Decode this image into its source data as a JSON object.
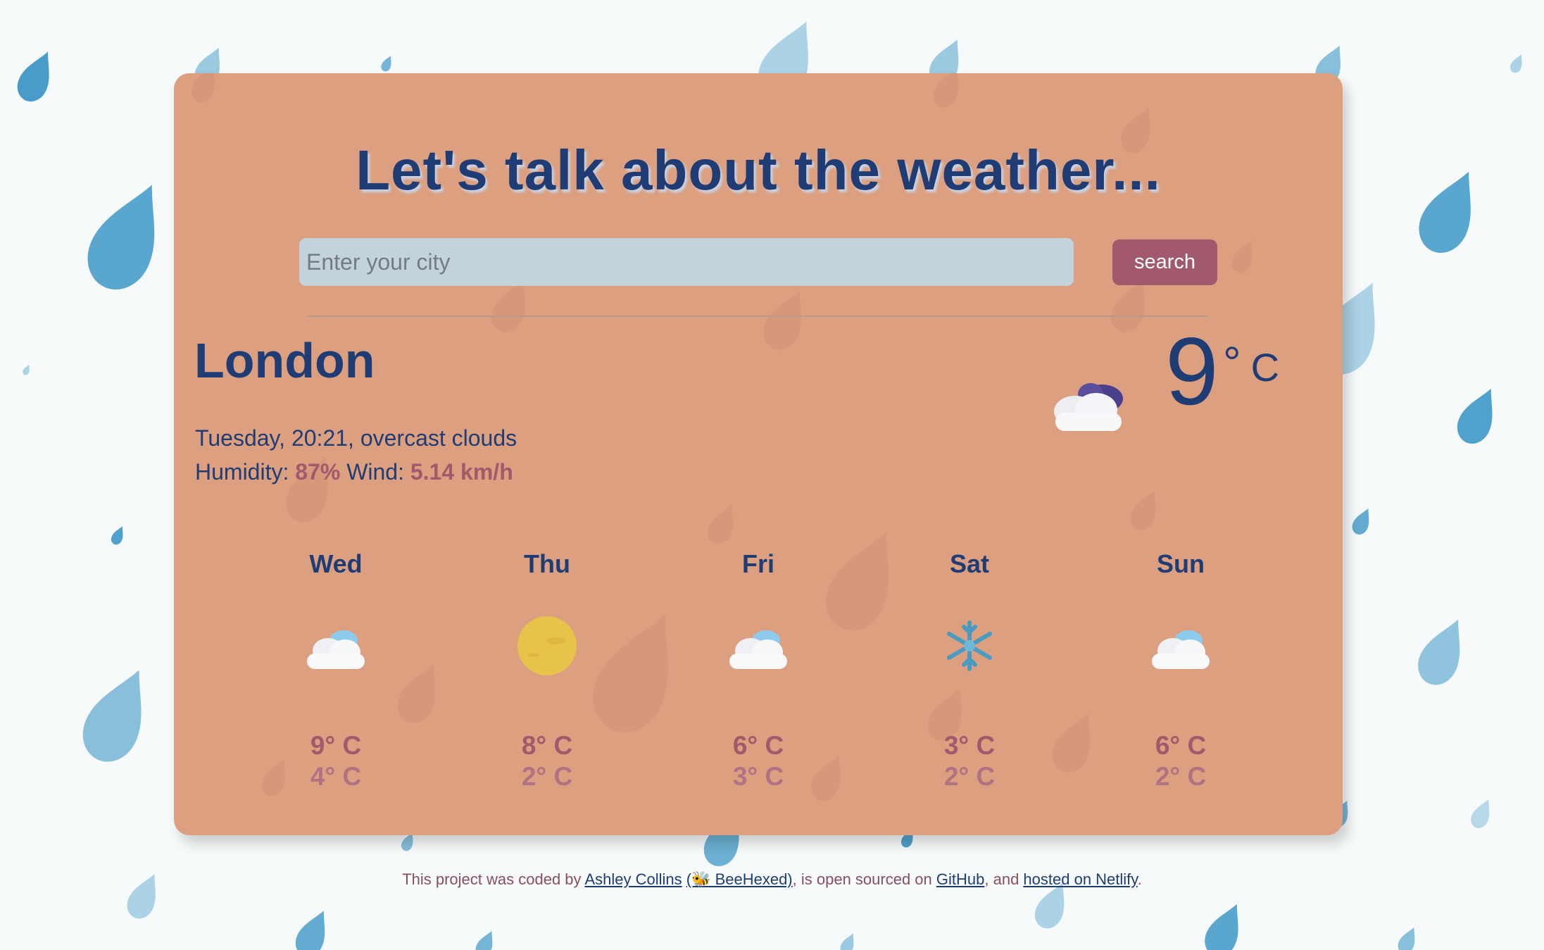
{
  "header": {
    "title": "Let's talk about the weather..."
  },
  "search": {
    "placeholder": "Enter your city",
    "button_label": "search"
  },
  "current": {
    "city": "London",
    "description_line": "Tuesday, 20:21, overcast clouds",
    "humidity_label": "Humidity:",
    "humidity_value": "87%",
    "wind_label": "Wind:",
    "wind_value": "5.14 km/h",
    "temperature": "9",
    "degree": "°",
    "unit": "C",
    "icon": "cloud-night-icon"
  },
  "forecast": [
    {
      "day": "Wed",
      "icon": "cloud-icon",
      "max": "9° C",
      "min": "4° C"
    },
    {
      "day": "Thu",
      "icon": "sun-icon",
      "max": "8° C",
      "min": "2° C"
    },
    {
      "day": "Fri",
      "icon": "cloud-icon",
      "max": "6° C",
      "min": "3° C"
    },
    {
      "day": "Sat",
      "icon": "snowflake-icon",
      "max": "3° C",
      "min": "2° C"
    },
    {
      "day": "Sun",
      "icon": "cloud-icon",
      "max": "6° C",
      "min": "2° C"
    }
  ],
  "footer": {
    "text_1": "This project was coded by ",
    "author_link": "Ashley Collins",
    "handle_link": "(🐝 BeeHexed)",
    "text_2": ", is open sourced on ",
    "github_link": "GitHub",
    "text_3": ", and ",
    "netlify_link": "hosted on Netlify",
    "text_4": "."
  },
  "colors": {
    "card": "#dca080",
    "title": "#1f3d74",
    "accent": "#a2596c",
    "input": "#c3d3dc",
    "drop": "#3d97c6"
  }
}
